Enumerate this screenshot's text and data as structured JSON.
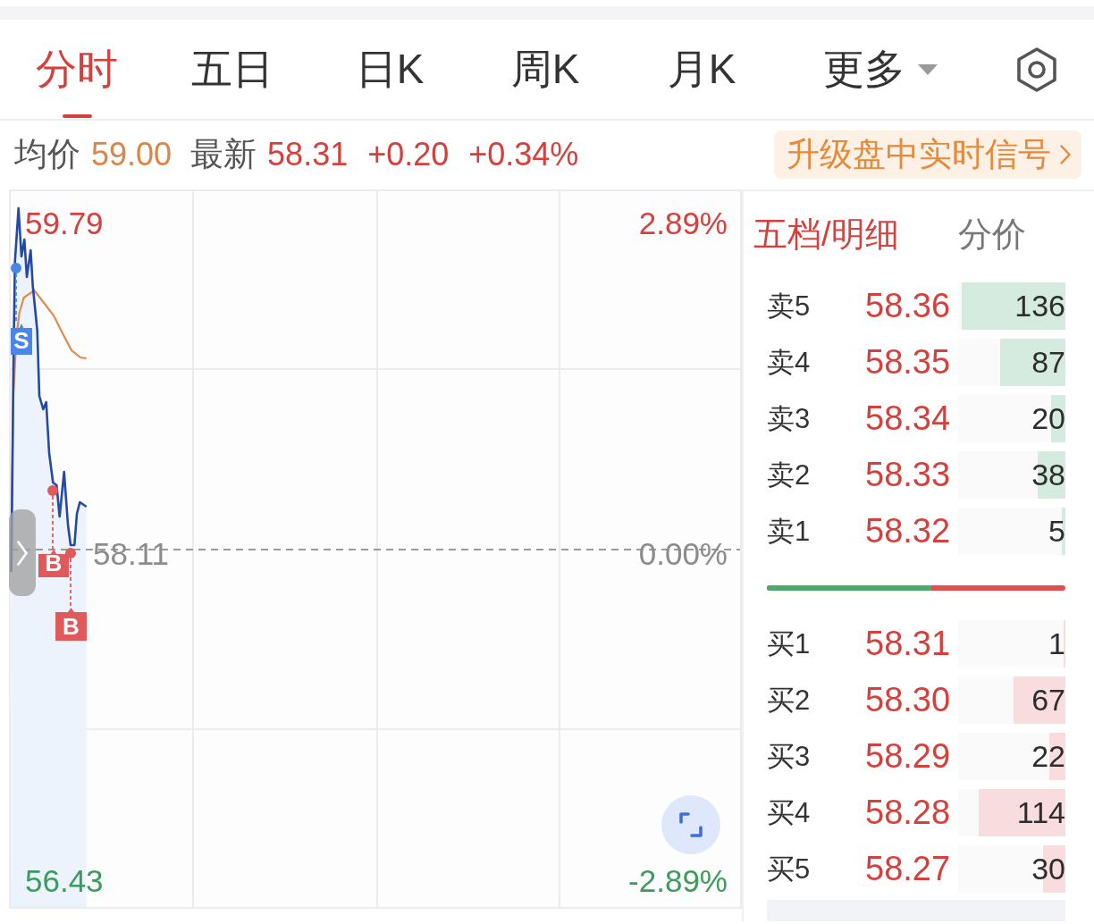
{
  "tabs": [
    {
      "label": "分时",
      "selected": true,
      "dropdown": false
    },
    {
      "label": "五日",
      "selected": false,
      "dropdown": false
    },
    {
      "label": "日K",
      "selected": false,
      "dropdown": false
    },
    {
      "label": "周K",
      "selected": false,
      "dropdown": false
    },
    {
      "label": "月K",
      "selected": false,
      "dropdown": false
    },
    {
      "label": "更多",
      "selected": false,
      "dropdown": true
    }
  ],
  "quote": {
    "avg_label": "均价",
    "avg_value": "59.00",
    "last_label": "最新",
    "last_value": "58.31",
    "change": "+0.20",
    "change_percent": "+0.34%",
    "signal_button": "升级盘中实时信号"
  },
  "chart": {
    "high_price": "59.79",
    "high_percent": "2.89%",
    "prev_close": "58.11",
    "zero_percent": "0.00%",
    "low_price": "56.43",
    "low_percent": "-2.89%",
    "trade_marks": [
      {
        "kind": "sell",
        "label": "S"
      },
      {
        "kind": "buy",
        "label": "B"
      },
      {
        "kind": "buy",
        "label": "B"
      }
    ]
  },
  "order_book": {
    "tabs": [
      {
        "label": "五档/明细",
        "selected": true
      },
      {
        "label": "分价",
        "selected": false
      }
    ],
    "asks": [
      {
        "label": "卖5",
        "price": "58.36",
        "volume": "136",
        "level": 0.97
      },
      {
        "label": "卖4",
        "price": "58.35",
        "volume": "87",
        "level": 0.61
      },
      {
        "label": "卖3",
        "price": "58.34",
        "volume": "20",
        "level": 0.13
      },
      {
        "label": "卖2",
        "price": "58.33",
        "volume": "38",
        "level": 0.26
      },
      {
        "label": "卖1",
        "price": "58.32",
        "volume": "5",
        "level": 0.03
      }
    ],
    "ratio": {
      "level": 0.55
    },
    "bids": [
      {
        "label": "买1",
        "price": "58.31",
        "volume": "1",
        "level": 0.02
      },
      {
        "label": "买2",
        "price": "58.30",
        "volume": "67",
        "level": 0.48
      },
      {
        "label": "买3",
        "price": "58.29",
        "volume": "22",
        "level": 0.15
      },
      {
        "label": "买4",
        "price": "58.28",
        "volume": "114",
        "level": 0.81
      },
      {
        "label": "买5",
        "price": "58.27",
        "volume": "30",
        "level": 0.21
      }
    ]
  }
}
